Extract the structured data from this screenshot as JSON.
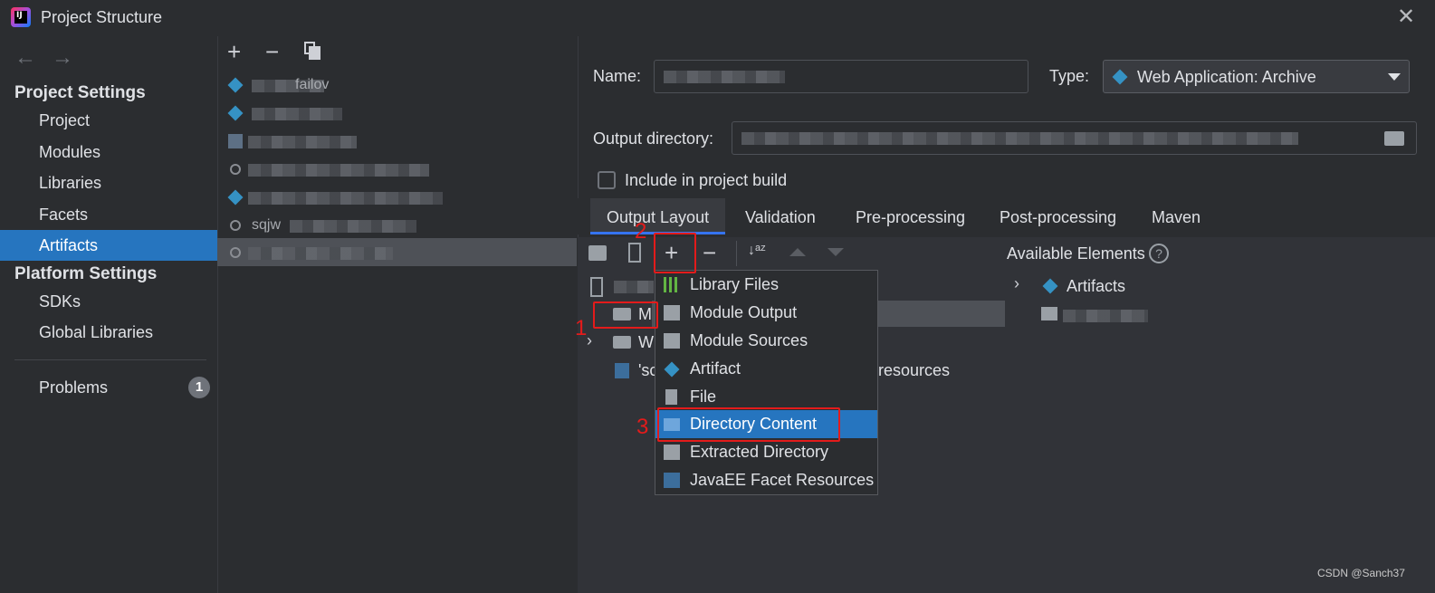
{
  "window": {
    "title": "Project Structure",
    "close_icon": "close-icon"
  },
  "sidebar": {
    "project_settings_header": "Project Settings",
    "project_items": [
      {
        "label": "Project"
      },
      {
        "label": "Modules"
      },
      {
        "label": "Libraries"
      },
      {
        "label": "Facets"
      },
      {
        "label": "Artifacts",
        "selected": true
      }
    ],
    "platform_settings_header": "Platform Settings",
    "platform_items": [
      {
        "label": "SDKs"
      },
      {
        "label": "Global Libraries"
      }
    ],
    "problems_label": "Problems",
    "problems_count": "1"
  },
  "artifact_list": {
    "rows": [
      {
        "visible_text": "failov",
        "icon": "artifact-diamond-icon"
      },
      {
        "visible_text": "",
        "icon": "artifact-diamond-icon"
      },
      {
        "visible_text": "",
        "icon": "archive-icon"
      },
      {
        "visible_text": "",
        "icon": "web-archive-icon"
      },
      {
        "visible_text": "",
        "icon": "artifact-diamond-icon"
      },
      {
        "visible_text": "sqjw",
        "icon": "web-archive-icon"
      },
      {
        "visible_text": "",
        "icon": "web-archive-icon",
        "selected": true
      }
    ]
  },
  "details": {
    "name_label": "Name:",
    "name_value": "",
    "type_label": "Type:",
    "type_value": "Web Application: Archive",
    "output_dir_label": "Output directory:",
    "output_dir_value": "",
    "include_in_build_label": "Include in project build",
    "include_in_build_checked": false,
    "tabs": [
      {
        "label": "Output Layout",
        "selected": true
      },
      {
        "label": "Validation"
      },
      {
        "label": "Pre-processing"
      },
      {
        "label": "Post-processing"
      },
      {
        "label": "Maven"
      }
    ],
    "available_elements_label": "Available Elements",
    "available_tree": [
      {
        "label": "Artifacts",
        "icon": "artifact-diamond-icon"
      }
    ],
    "layout_tree": [
      {
        "label": "M",
        "icon": "folder-icon"
      },
      {
        "label": "W",
        "icon": "folder-icon"
      },
      {
        "label": "'sc",
        "icon": "web-archive-icon"
      },
      {
        "label": "resources"
      }
    ]
  },
  "add_menu": {
    "items": [
      {
        "label": "Library Files",
        "icon": "library-icon"
      },
      {
        "label": "Module Output",
        "icon": "module-output-icon"
      },
      {
        "label": "Module Sources",
        "icon": "module-sources-icon"
      },
      {
        "label": "Artifact",
        "icon": "artifact-diamond-icon"
      },
      {
        "label": "File",
        "icon": "file-icon"
      },
      {
        "label": "Directory Content",
        "icon": "directory-icon",
        "selected": true
      },
      {
        "label": "Extracted Directory",
        "icon": "extracted-directory-icon"
      },
      {
        "label": "JavaEE Facet Resources",
        "icon": "javaee-icon"
      }
    ]
  },
  "annotations": {
    "step1": "1",
    "step2": "2",
    "step3": "3",
    "color": "#e31b1b"
  },
  "watermark": "CSDN @Sanch37",
  "colors": {
    "selection": "#2675bf",
    "background": "#2b2d30",
    "annotation_red": "#e31b1b"
  }
}
